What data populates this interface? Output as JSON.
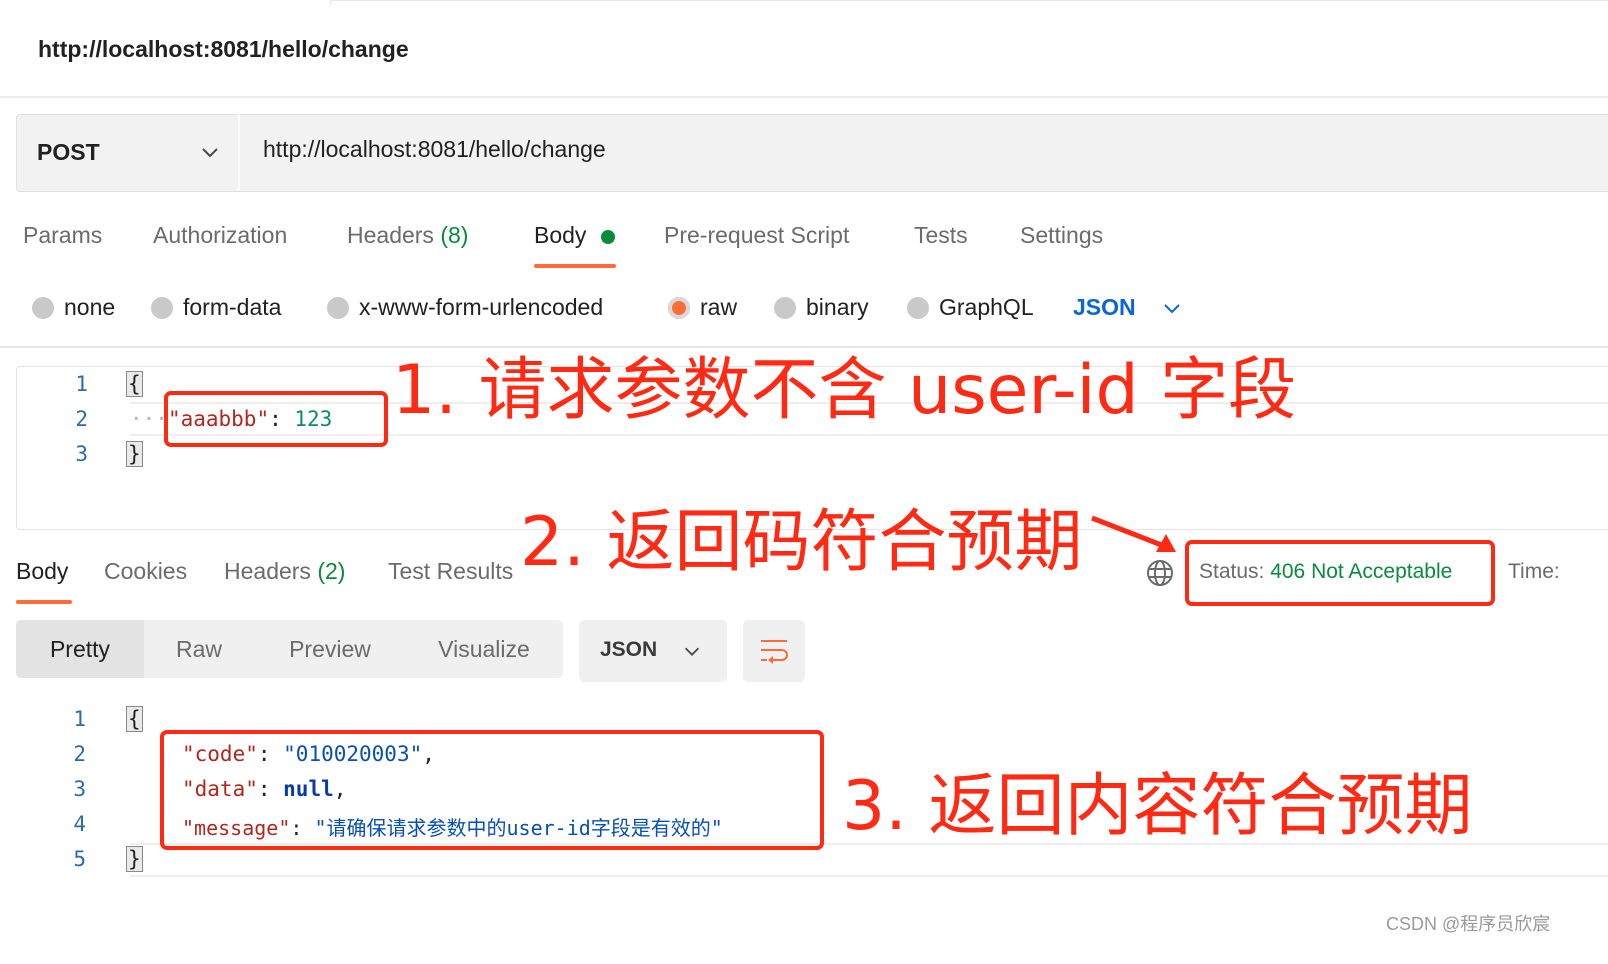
{
  "request": {
    "title": "http://localhost:8081/hello/change",
    "method": "POST",
    "url": "http://localhost:8081/hello/change"
  },
  "request_tabs": {
    "params": "Params",
    "authorization": "Authorization",
    "headers": "Headers",
    "headers_count": "(8)",
    "body": "Body",
    "prerequest": "Pre-request Script",
    "tests": "Tests",
    "settings": "Settings"
  },
  "body_types": {
    "none": "none",
    "form_data": "form-data",
    "urlencoded": "x-www-form-urlencoded",
    "raw": "raw",
    "binary": "binary",
    "graphql": "GraphQL",
    "selected": "raw",
    "format": "JSON"
  },
  "request_body": {
    "line_numbers": [
      "1",
      "2",
      "3"
    ],
    "open_brace": "{",
    "close_brace": "}",
    "key": "\"aaabbb\"",
    "colon": ": ",
    "value": "123"
  },
  "response_tabs": {
    "body": "Body",
    "cookies": "Cookies",
    "headers": "Headers",
    "headers_count": "(2)",
    "test_results": "Test Results"
  },
  "status": {
    "label": "Status: ",
    "value": "406 Not Acceptable",
    "time_label": "Time:"
  },
  "view_modes": {
    "pretty": "Pretty",
    "raw": "Raw",
    "preview": "Preview",
    "visualize": "Visualize",
    "format": "JSON"
  },
  "response_body": {
    "line_numbers": [
      "1",
      "2",
      "3",
      "4",
      "5"
    ],
    "open_brace": "{",
    "close_brace": "}",
    "code_key": "\"code\"",
    "code_value": "\"010020003\"",
    "data_key": "\"data\"",
    "data_value": "null",
    "message_key": "\"message\"",
    "message_value": "\"请确保请求参数中的user-id字段是有效的\"",
    "colon": ": ",
    "comma": ","
  },
  "annotations": {
    "a1": "1. 请求参数不含 user-id 字段",
    "a2": "2. 返回码符合预期",
    "a3": "3. 返回内容符合预期"
  },
  "watermark": "CSDN @程序员欣宸",
  "colors": {
    "accent": "#ff6c37",
    "success": "#0b8a3d",
    "annotation": "#ff2a14",
    "link_blue": "#0a66d8"
  },
  "icons": {
    "method_dropdown": "chevron-down-icon",
    "format_dropdown": "chevron-down-icon",
    "network": "globe-icon",
    "wrap": "wrap-lines-icon",
    "arrow": "arrow-icon"
  }
}
